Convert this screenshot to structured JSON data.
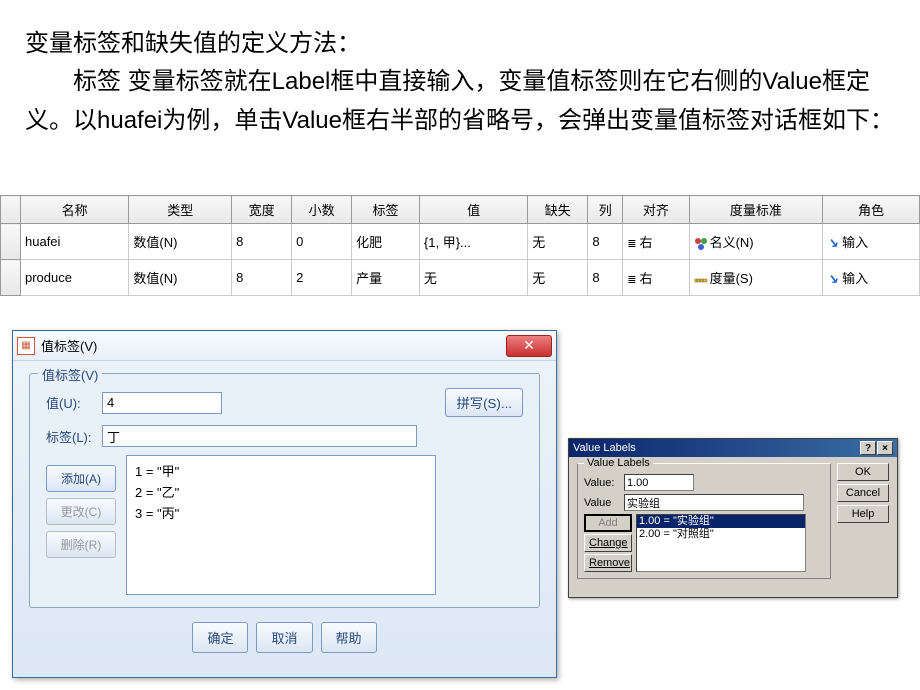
{
  "intro": {
    "line1": "变量标签和缺失值的定义方法：",
    "line2": "标签 变量标签就在Label框中直接输入，变量值标签则在它右侧的Value框定义。以huafei为例，单击Value框右半部的省略号，会弹出变量值标签对话框如下："
  },
  "table": {
    "headers": [
      "",
      "名称",
      "类型",
      "宽度",
      "小数",
      "标签",
      "值",
      "缺失",
      "列",
      "对齐",
      "度量标准",
      "角色"
    ],
    "rows": [
      {
        "name": "huafei",
        "type": "数值(N)",
        "width": "8",
        "decimals": "0",
        "label": "化肥",
        "values": "{1, 甲}...",
        "missing": "无",
        "columns": "8",
        "align": "右",
        "measure": "名义(N)",
        "role": "输入"
      },
      {
        "name": "produce",
        "type": "数值(N)",
        "width": "8",
        "decimals": "2",
        "label": "产量",
        "values": "无",
        "missing": "无",
        "columns": "8",
        "align": "右",
        "measure": "度量(S)",
        "role": "输入"
      }
    ]
  },
  "dialog1": {
    "title": "值标签(V)",
    "legend": "值标签(V)",
    "value_label": "值(U):",
    "value_input": "4",
    "label_label": "标签(L):",
    "label_input": "丁",
    "spell": "拼写(S)...",
    "add": "添加(A)",
    "change": "更改(C)",
    "remove": "删除(R)",
    "list": [
      "1 = \"甲\"",
      "2 = \"乙\"",
      "3 = \"丙\""
    ],
    "ok": "确定",
    "cancel": "取消",
    "help": "帮助"
  },
  "dialog2": {
    "title": "Value Labels",
    "legend": "Value Labels",
    "value_label": "Value:",
    "value_input": "1.00",
    "label_label": "Value",
    "label_input": "实验组",
    "add": "Add",
    "change": "Change",
    "remove": "Remove",
    "list": [
      "1.00 = \"实验组\"",
      "2.00 = \"对照组\""
    ],
    "ok": "OK",
    "cancel": "Cancel",
    "help": "Help"
  }
}
